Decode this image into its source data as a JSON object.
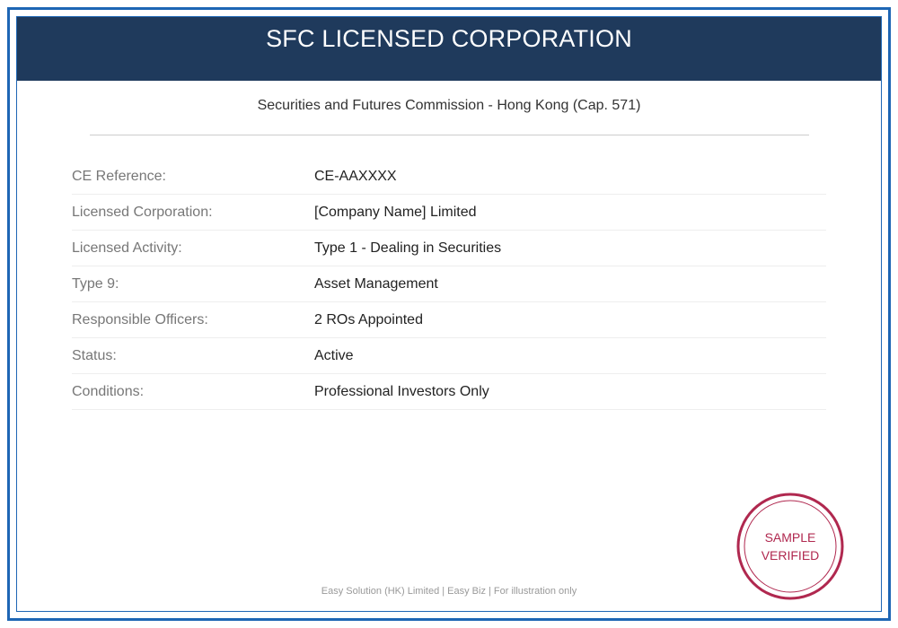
{
  "header": {
    "title": "SFC LICENSED CORPORATION"
  },
  "subtitle": "Securities and Futures Commission - Hong Kong (Cap. 571)",
  "details": [
    {
      "label": "CE Reference:",
      "value": "CE-AAXXXX"
    },
    {
      "label": "Licensed Corporation:",
      "value": "[Company Name] Limited"
    },
    {
      "label": "Licensed Activity:",
      "value": "Type 1 - Dealing in Securities"
    },
    {
      "label": "Type 9:",
      "value": "Asset Management"
    },
    {
      "label": "Responsible Officers:",
      "value": "2 ROs Appointed"
    },
    {
      "label": "Status:",
      "value": "Active"
    },
    {
      "label": "Conditions:",
      "value": "Professional Investors Only"
    }
  ],
  "stamp": {
    "line1": "SAMPLE",
    "line2": "VERIFIED",
    "color": "#b0284f"
  },
  "footer": "Easy Solution (HK) Limited | Easy Biz | For illustration only",
  "colors": {
    "header_background": "#1f3a5c",
    "frame_border": "#1e66b4",
    "stamp": "#b0284f"
  }
}
